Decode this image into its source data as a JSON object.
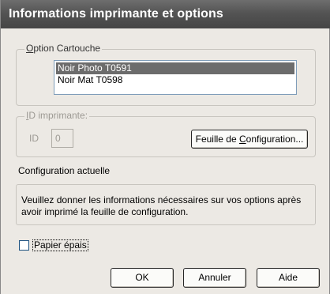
{
  "window": {
    "title": "Informations imprimante et options"
  },
  "cartridge_group": {
    "label_accel": "O",
    "label_rest": "ption Cartouche",
    "items": [
      {
        "label": "Noir Photo T0591",
        "selected": true
      },
      {
        "label": "Noir Mat T0598",
        "selected": false
      }
    ]
  },
  "printer_id_group": {
    "label_accel": "I",
    "label_rest": "D imprimante:",
    "id_label": "ID",
    "id_value": "0",
    "config_sheet_button_prefix": "Feuille de ",
    "config_sheet_button_accel": "C",
    "config_sheet_button_rest": "onfiguration..."
  },
  "current_config": {
    "title": "Configuration actuelle",
    "info_line1": "Veuillez donner les informations nécessaires sur vos options après",
    "info_line2": "avoir imprimé la feuille de configuration."
  },
  "thick_paper": {
    "label": "Papier épais",
    "checked": false
  },
  "buttons": {
    "ok": "OK",
    "cancel": "Annuler",
    "help": "Aide"
  }
}
